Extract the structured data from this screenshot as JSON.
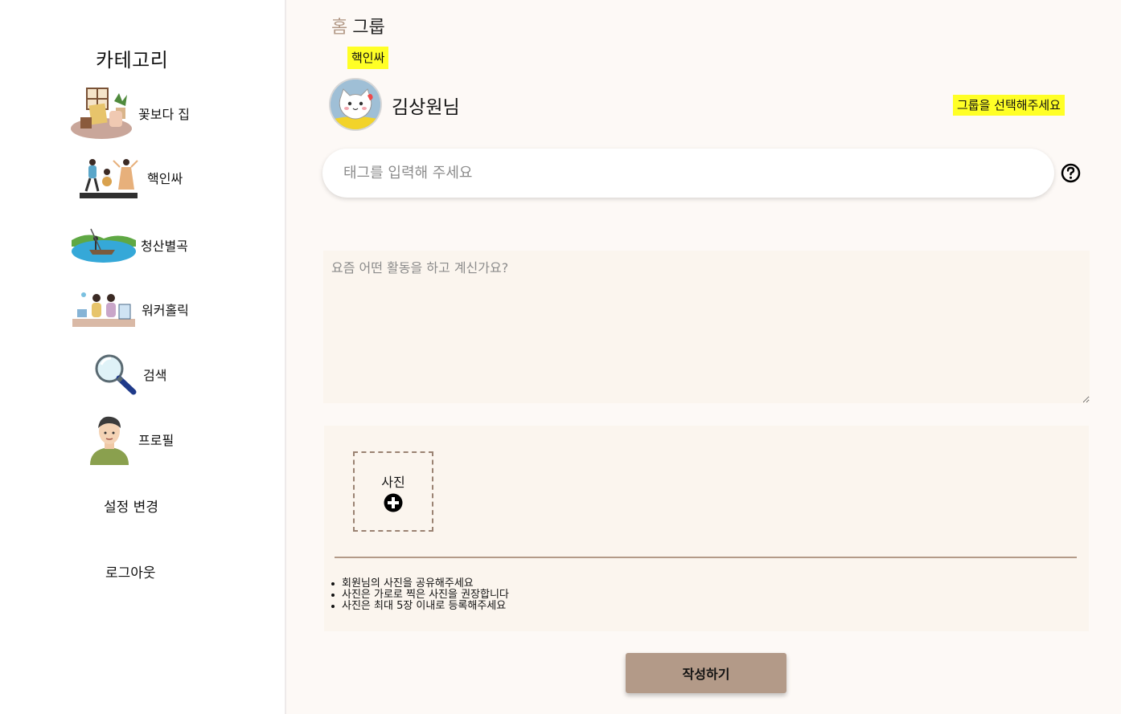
{
  "sidebar": {
    "title": "카테고리",
    "items": [
      {
        "label": "꽃보다 집",
        "icon": "house-illustration-icon"
      },
      {
        "label": "핵인싸",
        "icon": "people-dancing-illustration-icon"
      },
      {
        "label": "청산별곡",
        "icon": "river-boat-illustration-icon"
      },
      {
        "label": "워커홀릭",
        "icon": "office-workers-illustration-icon"
      },
      {
        "label": "검색",
        "icon": "magnifier-icon"
      },
      {
        "label": "프로필",
        "icon": "person-avatar-icon"
      }
    ],
    "settings_label": "설정 변경",
    "logout_label": "로그아웃"
  },
  "breadcrumb": {
    "home": "홈",
    "current": "그룹"
  },
  "group_badge": "핵인싸",
  "user": {
    "name": "김상원님",
    "avatar_icon": "cat-avatar-icon"
  },
  "select_group_label": "그룹을 선택해주세요",
  "tag_input": {
    "placeholder": "태그를 입력해 주세요",
    "value": ""
  },
  "activity_input": {
    "placeholder": "요즘 어떤 활동을 하고 계신가요?",
    "value": ""
  },
  "photo": {
    "label": "사진",
    "notes": [
      "회원님의 사진을 공유해주세요",
      "사진은 가로로 찍은 사진을 권장합니다",
      "사진은 최대 5장 이내로 등록해주세요"
    ]
  },
  "submit_label": "작성하기",
  "colors": {
    "accent": "#b39a88",
    "highlight": "#ffff26",
    "panel": "#fbf5ee",
    "background": "#fdf9f6"
  }
}
